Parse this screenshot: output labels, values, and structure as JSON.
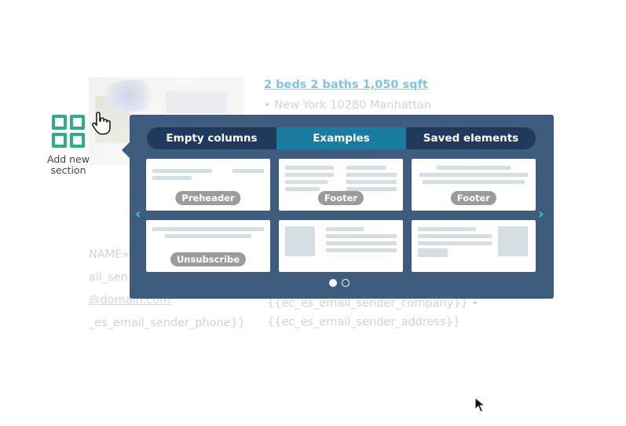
{
  "background": {
    "listing_link": "2 beds 2 baths 1,050 sqft",
    "location": "New York 10280 Manhattan",
    "frag_name": "NAME»",
    "frag_sender": "ail_sen",
    "frag_domain": "@domain.com",
    "frag_phone": "_es_email_sender_phone}}",
    "frag_company": "{{ec_es_email_sender_company}} •",
    "frag_address": "{{ec_es_email_sender_address}}"
  },
  "add_section": {
    "label_line1": "Add new",
    "label_line2": "section",
    "icon": "grid-icon"
  },
  "panel": {
    "tabs": [
      {
        "label": "Empty columns",
        "active": false
      },
      {
        "label": "Examples",
        "active": true
      },
      {
        "label": "Saved elements",
        "active": false
      }
    ],
    "cards": [
      {
        "badge": "Preheader"
      },
      {
        "badge": "Footer"
      },
      {
        "badge": "Footer"
      },
      {
        "badge": "Unsubscribe"
      },
      {
        "badge": ""
      },
      {
        "badge": ""
      }
    ],
    "prev_icon": "chevron-left-icon",
    "next_icon": "chevron-right-icon",
    "pages": 2,
    "current_page": 1
  },
  "colors": {
    "panel": "#3e5d7e",
    "tabs_bg": "#1f3a5b",
    "tab_active": "#1a7ba0",
    "accent_green": "#2fae86",
    "arrow_teal": "#2fd3c0"
  }
}
